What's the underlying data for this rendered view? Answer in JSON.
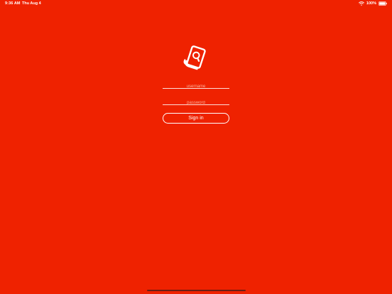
{
  "status_bar": {
    "time": "9:36 AM",
    "date": "Thu Aug 4",
    "battery": "100%"
  },
  "logo": {
    "icon": "receipt-search-icon"
  },
  "form": {
    "username_placeholder": "username",
    "password_placeholder": "password",
    "signin_label": "Sign in"
  },
  "colors": {
    "background": "#ef2200",
    "foreground": "#ffffff"
  }
}
